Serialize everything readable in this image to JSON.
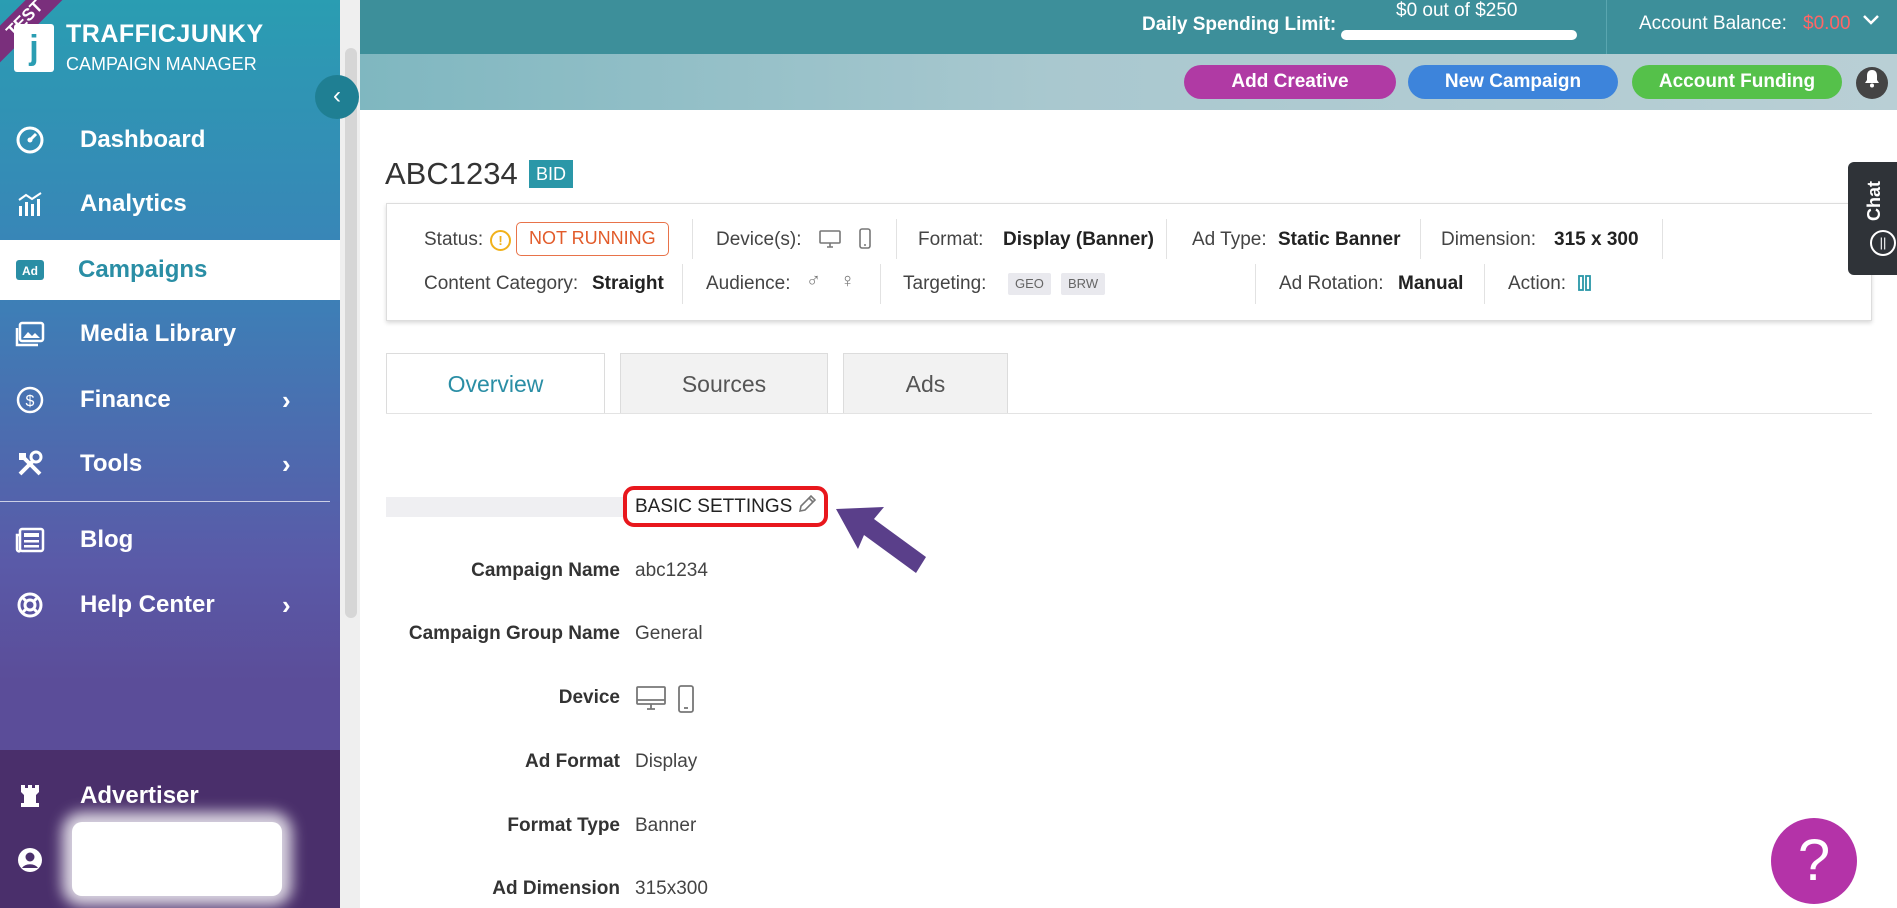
{
  "sidebar": {
    "test_ribbon": "TEST",
    "logo_mark": "j",
    "logo_title": "TRAFFICJUNKY",
    "logo_subtitle": "CAMPAIGN MANAGER",
    "items": [
      {
        "label": "Dashboard",
        "icon": "gauge-icon"
      },
      {
        "label": "Analytics",
        "icon": "chart-icon"
      },
      {
        "label": "Campaigns",
        "icon": "ad-icon",
        "active": true
      },
      {
        "label": "Media Library",
        "icon": "image-icon"
      },
      {
        "label": "Finance",
        "icon": "dollar-icon",
        "has_submenu": true
      },
      {
        "label": "Tools",
        "icon": "tools-icon",
        "has_submenu": true
      },
      {
        "label": "Blog",
        "icon": "newspaper-icon"
      },
      {
        "label": "Help Center",
        "icon": "lifebuoy-icon",
        "has_submenu": true
      },
      {
        "label": "Advertiser",
        "icon": "rook-icon"
      }
    ]
  },
  "header": {
    "spending_label": "Daily Spending Limit:",
    "spending_value": "$0 out of $250",
    "balance_label": "Account Balance:",
    "balance_value": "$0.00",
    "buttons": {
      "add_creative": "Add Creative",
      "new_campaign": "New Campaign",
      "account_funding": "Account Funding"
    }
  },
  "campaign": {
    "title": "ABC1234",
    "badge": "BID",
    "info": {
      "status_label": "Status:",
      "status_value": "NOT RUNNING",
      "devices_label": "Device(s):",
      "format_label": "Format:",
      "format_value": "Display (Banner)",
      "adtype_label": "Ad Type:",
      "adtype_value": "Static Banner",
      "dimension_label": "Dimension:",
      "dimension_value": "315 x 300",
      "category_label": "Content Category:",
      "category_value": "Straight",
      "audience_label": "Audience:",
      "targeting_label": "Targeting:",
      "targeting_tags": [
        "GEO",
        "BRW"
      ],
      "rotation_label": "Ad Rotation:",
      "rotation_value": "Manual",
      "action_label": "Action:"
    }
  },
  "chat_tab": "Chat",
  "tabs": [
    "Overview",
    "Sources",
    "Ads"
  ],
  "basic_settings": {
    "title": "BASIC SETTINGS",
    "fields": [
      {
        "label": "Campaign Name",
        "value": "abc1234"
      },
      {
        "label": "Campaign Group Name",
        "value": "General"
      },
      {
        "label": "Device",
        "value": ""
      },
      {
        "label": "Ad Format",
        "value": "Display"
      },
      {
        "label": "Format Type",
        "value": "Banner"
      },
      {
        "label": "Ad Dimension",
        "value": "315x300"
      }
    ]
  },
  "help_button": "?",
  "colors": {
    "accent": "#2a8ea5",
    "add_creative": "#b03aa4",
    "new_campaign": "#3d84db",
    "account_funding": "#55c14a",
    "status_not_running": "#e25b2a",
    "highlight": "#e8171d",
    "arrow": "#5a3f8a"
  }
}
